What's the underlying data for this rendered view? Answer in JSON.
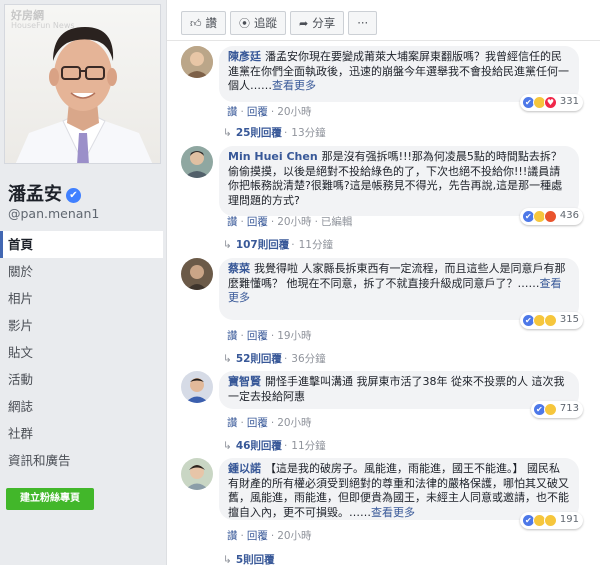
{
  "profile": {
    "watermark": "好房網",
    "watermark_sub": "HouseFun News",
    "name": "潘孟安",
    "verified_mark": "✔",
    "handle": "@pan.menan1"
  },
  "nav": [
    {
      "label": "首頁",
      "active": true
    },
    {
      "label": "關於"
    },
    {
      "label": "相片"
    },
    {
      "label": "影片"
    },
    {
      "label": "貼文"
    },
    {
      "label": "活動"
    },
    {
      "label": "網誌"
    },
    {
      "label": "社群"
    },
    {
      "label": "資訊和廣告"
    }
  ],
  "create_page_label": "建立粉絲專頁",
  "actions": {
    "like": "讚",
    "follow": "追蹤",
    "share": "分享",
    "more": "···"
  },
  "comments": [
    {
      "name": "陳彥廷",
      "text": "潘孟安你現在要變成莆萊大埔案屏東翻版嗎？我曾經信任的民進黨在你們全面執政後，迅速的崩盤今年選舉我不會投給民進黨任何一個人……",
      "more": "查看更多",
      "reactions": [
        "like",
        "haha",
        "heart"
      ],
      "count": "331",
      "meta": {
        "like": "讚",
        "reply": "回覆",
        "time": "20小時"
      },
      "replies": {
        "label": "25則回覆",
        "time": "13分鐘"
      }
    },
    {
      "name": "Min Huei Chen",
      "text": "那是沒有强拆嗎!!!那為何凌晨5點的時間點去拆？偷偷摸摸，以後是絕對不投給綠色的了，下次也絕不投給你!!!議員請你把帳務說清楚?很難嗎?這是帳務見不得光，先告再說,這是那一種處理問題的方式?",
      "more": "",
      "reactions": [
        "like",
        "haha",
        "angry"
      ],
      "count": "436",
      "meta": {
        "like": "讚",
        "reply": "回覆",
        "time": "20小時",
        "edited": "已編輯"
      },
      "replies": {
        "label": "107則回覆",
        "time": "11分鐘"
      }
    },
    {
      "name": "蔡菜",
      "text": "我覺得啦 人家縣長拆東西有一定流程，而且這些人是同意戶有那麼難懂嗎？ 他現在不同意，拆了不就直接升級成同意戶了？……",
      "more": "查看更多",
      "reactions": [
        "like",
        "haha",
        "sad"
      ],
      "count": "315",
      "meta": {
        "like": "讚",
        "reply": "回覆",
        "time": "19小時"
      },
      "replies": {
        "label": "52則回覆",
        "time": "36分鐘"
      }
    },
    {
      "name": "寶智賢",
      "text": "開怪手進擊叫溝通 我屏東市活了38年 從來不投票的人 這次我一定去投給阿惠",
      "more": "",
      "reactions": [
        "like",
        "haha"
      ],
      "count": "713",
      "meta": {
        "like": "讚",
        "reply": "回覆",
        "time": "20小時"
      },
      "replies": {
        "label": "46則回覆",
        "time": "11分鐘"
      }
    },
    {
      "name": "鍾以諾",
      "text": "【這是我的破房子。風能進，雨能進，國王不能進。】 國民私有財產的所有權必須受到絕對的尊重和法律的嚴格保護，哪怕其又破又舊，風能進，雨能進，但即便貴為國王，未經主人同意或邀請，也不能擅自入內，更不可損毀。……",
      "more": "查看更多",
      "reactions": [
        "like",
        "haha",
        "sad"
      ],
      "count": "191",
      "meta": {
        "like": "讚",
        "reply": "回覆",
        "time": "20小時"
      },
      "replies": {
        "label": "5則回覆",
        "time": ""
      }
    }
  ]
}
